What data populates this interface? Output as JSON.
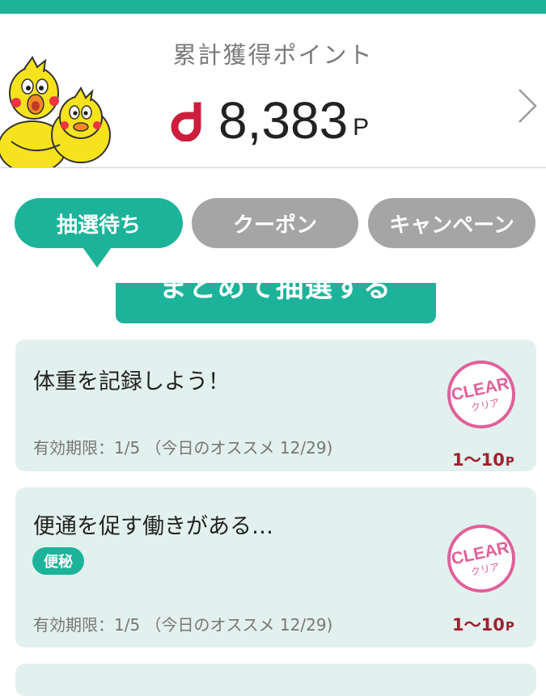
{
  "colors": {
    "accent": "#1db39a",
    "inactive_tab": "#a5a5a5",
    "card_bg": "#e2f1ee",
    "stamp": "#e0609a",
    "reward": "#a02030"
  },
  "header": {
    "title": "累計獲得ポイント",
    "points": "8,383",
    "unit": "P",
    "logo_letter": "d",
    "arrow_icon": "chevron-right-icon"
  },
  "tabs": [
    {
      "label": "抽選待ち",
      "active": true
    },
    {
      "label": "クーポン",
      "active": false
    },
    {
      "label": "キャンペーン",
      "active": false
    }
  ],
  "draw_button": {
    "label": "まとめて抽選する"
  },
  "cards": [
    {
      "title": "体重を記録しよう！",
      "expiry": "有効期限：1/5 （今日のオススメ 12/29)",
      "stamp_en": "CLEAR",
      "stamp_ja": "クリア",
      "reward": "1〜10",
      "reward_unit": "P"
    },
    {
      "title": "便通を促す働きがある…",
      "badge": "便秘",
      "expiry": "有効期限：1/5 （今日のオススメ 12/29)",
      "stamp_en": "CLEAR",
      "stamp_ja": "クリア",
      "reward": "1〜10",
      "reward_unit": "P"
    }
  ]
}
